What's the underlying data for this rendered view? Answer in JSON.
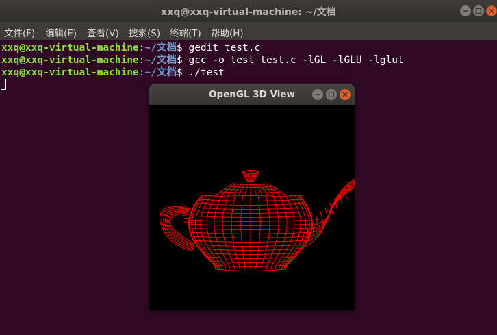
{
  "window": {
    "title": "xxq@xxq-virtual-machine: ~/文档"
  },
  "menu": [
    "文件(F)",
    "编辑(E)",
    "查看(V)",
    "搜索(S)",
    "终端(T)",
    "帮助(H)"
  ],
  "terminal": {
    "lines": [
      {
        "user": "xxq@xxq-virtual-machine",
        "sep": ":",
        "path": "~/文档",
        "prompt": "$ ",
        "cmd": "gedit test.c"
      },
      {
        "user": "xxq@xxq-virtual-machine",
        "sep": ":",
        "path": "~/文档",
        "prompt": "$ ",
        "cmd": "gcc -o test test.c -lGL -lGLU -lglut"
      },
      {
        "user": "xxq@xxq-virtual-machine",
        "sep": ":",
        "path": "~/文档",
        "prompt": "$ ",
        "cmd": "./test"
      }
    ]
  },
  "glwindow": {
    "title": "OpenGL 3D View",
    "content": "teapot-wireframe",
    "wire_color": "#ff0000"
  },
  "colors": {
    "terminal_bg": "#300a24",
    "user": "#8ae234",
    "path": "#729fcf",
    "close_button": "#e1602d"
  }
}
